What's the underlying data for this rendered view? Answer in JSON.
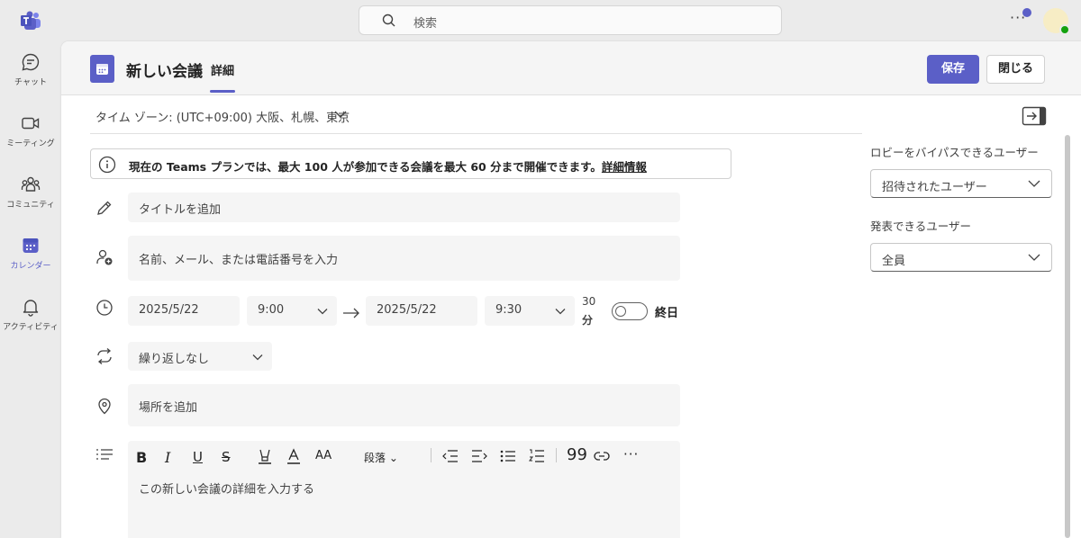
{
  "search": {
    "placeholder": "検索"
  },
  "rail": {
    "items": [
      {
        "label": "チャット",
        "icon": "chat-icon"
      },
      {
        "label": "ミーティング",
        "icon": "video-icon"
      },
      {
        "label": "コミュニティ",
        "icon": "community-icon"
      },
      {
        "label": "カレンダー",
        "icon": "calendar-icon",
        "active": true
      },
      {
        "label": "アクティビティ",
        "icon": "bell-icon"
      }
    ]
  },
  "header": {
    "title": "新しい会議",
    "tab": "詳細",
    "save_label": "保存",
    "close_label": "閉じる"
  },
  "timezone": {
    "label": "タイム ゾーン: (UTC+09:00) 大阪、札幌、東京"
  },
  "info": {
    "text": "現在の Teams プランでは、最大 100 人が参加できる会議を最大 60 分まで開催できます。",
    "link": "詳細情報"
  },
  "form": {
    "title_placeholder": "タイトルを追加",
    "attendees_placeholder": "名前、メール、または電話番号を入力",
    "start_date": "2025/5/22",
    "start_time": "9:00",
    "end_date": "2025/5/22",
    "end_time": "9:30",
    "duration_value": "30",
    "duration_unit": "分",
    "all_day_label": "終日",
    "all_day_on": false,
    "repeat_value": "繰り返しなし",
    "location_placeholder": "場所を追加",
    "paragraph_label": "段落",
    "details_placeholder": "この新しい会議の詳細を入力する"
  },
  "side": {
    "lobby_label": "ロビーをバイパスできるユーザー",
    "lobby_value": "招待されたユーザー",
    "presenters_label": "発表できるユーザー",
    "presenters_value": "全員"
  },
  "colors": {
    "accent": "#5b5fc7",
    "panel": "#ffffff",
    "background": "#ebebeb"
  }
}
